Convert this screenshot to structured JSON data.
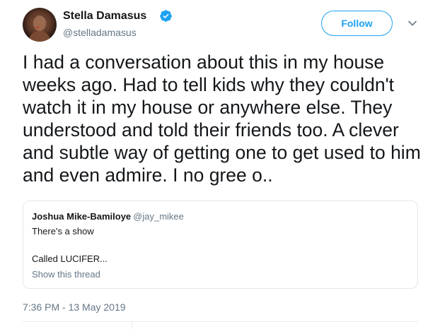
{
  "author": {
    "name": "Stella Damasus",
    "handle": "@stelladamasus",
    "verified": true,
    "avatar_icon": "profile-photo"
  },
  "actions": {
    "follow_label": "Follow",
    "menu_icon": "chevron-down-icon"
  },
  "tweet": {
    "text": "I had a conversation about this in my house weeks ago. Had to tell kids why they couldn't watch it in my house or anywhere else. They understood and told their friends too. A clever and subtle way of getting one to get used to him and even admire. I no gree o..",
    "timestamp": "7:36 PM - 13 May 2019"
  },
  "quoted_tweet": {
    "author_name": "Joshua Mike-Bamiloye",
    "author_handle": "@jay_mikee",
    "line1": "There's a show",
    "line2": "Called LUCIFER...",
    "show_thread_label": "Show this thread"
  },
  "colors": {
    "accent": "#1da1f2",
    "text": "#14171a",
    "muted": "#657786",
    "border": "#e1e8ed"
  }
}
